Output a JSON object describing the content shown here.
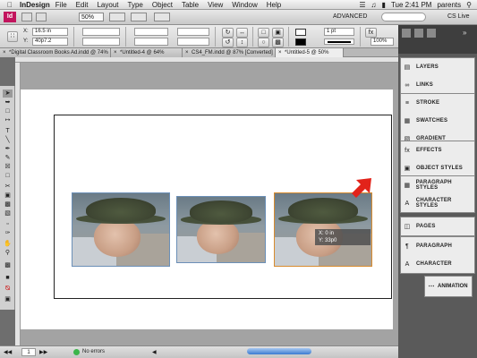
{
  "menubar": {
    "app_name": "InDesign",
    "items": [
      "File",
      "Edit",
      "Layout",
      "Type",
      "Object",
      "Table",
      "View",
      "Window",
      "Help"
    ],
    "clock": "Tue 2:41 PM",
    "user": "parents"
  },
  "appbar": {
    "zoom": "50%",
    "workspace": "ADVANCED",
    "search_placeholder": "",
    "cs_live": "CS Live"
  },
  "controlbar": {
    "x_value": "16.5 in",
    "y_value": "40p7.2",
    "stroke_weight": "1 pt",
    "percent": "100%"
  },
  "tabs": [
    {
      "label": "*Digital Classroom Books Ad.indd @ 74%"
    },
    {
      "label": "*Untitled-4 @ 64%"
    },
    {
      "label": "CS4_FM.indd @ 87% [Converted]"
    },
    {
      "label": "*Untitled-5 @ 50%",
      "active": true
    }
  ],
  "canvas": {
    "tooltip_x": "X: 0 in",
    "tooltip_y": "Y: 33p0"
  },
  "panels": [
    {
      "label": "LAYERS",
      "icon": "layers-icon"
    },
    {
      "label": "LINKS",
      "icon": "links-icon"
    },
    {
      "label": "STROKE",
      "icon": "stroke-icon"
    },
    {
      "label": "SWATCHES",
      "icon": "swatches-icon"
    },
    {
      "label": "GRADIENT",
      "icon": "gradient-icon"
    },
    {
      "label": "EFFECTS",
      "icon": "effects-icon"
    },
    {
      "label": "OBJECT STYLES",
      "icon": "object-styles-icon"
    },
    {
      "label": "PARAGRAPH STYLES",
      "icon": "paragraph-styles-icon"
    },
    {
      "label": "CHARACTER STYLES",
      "icon": "character-styles-icon"
    },
    {
      "label": "PAGES",
      "icon": "pages-icon"
    },
    {
      "label": "PARAGRAPH",
      "icon": "paragraph-icon"
    },
    {
      "label": "CHARACTER",
      "icon": "character-icon"
    }
  ],
  "animation_panel": "ANIMATION",
  "statusbar": {
    "page": "1",
    "errors": "No errors"
  },
  "colors": {
    "selection_frame": "#6b8fb7",
    "active_frame": "#d88b2e",
    "arrow": "#e2231a"
  }
}
